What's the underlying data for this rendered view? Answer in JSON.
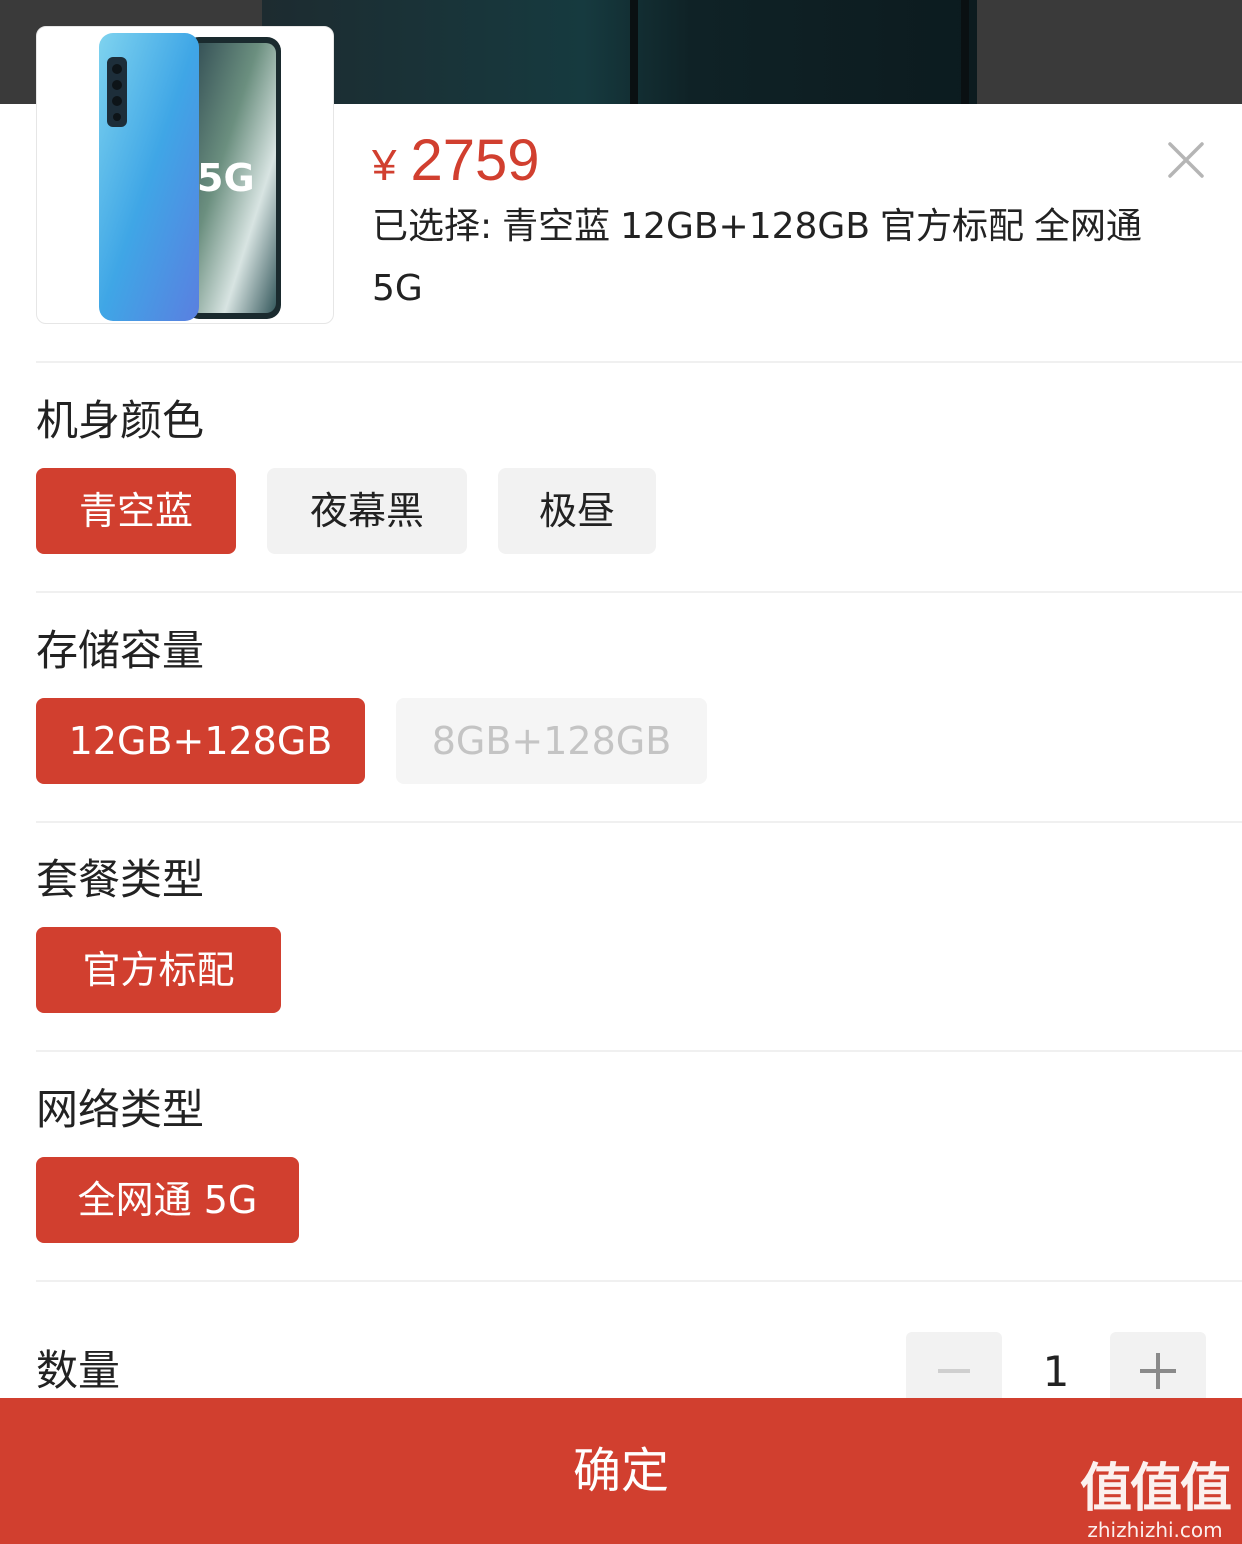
{
  "product": {
    "price_currency": "¥",
    "price_value": "2759",
    "selected_label": "已选择:",
    "selected_color": "青空蓝",
    "selected_storage": "12GB+128GB",
    "selected_package": "官方标配",
    "selected_network": "全网通 5G",
    "image_text": "5G"
  },
  "sections": {
    "color": {
      "title": "机身颜色",
      "options": [
        "青空蓝",
        "夜幕黑",
        "极昼"
      ],
      "selected": "青空蓝"
    },
    "storage": {
      "title": "存储容量",
      "options": [
        "12GB+128GB",
        "8GB+128GB"
      ],
      "selected": "12GB+128GB",
      "disabled": [
        "8GB+128GB"
      ]
    },
    "package": {
      "title": "套餐类型",
      "options": [
        "官方标配"
      ],
      "selected": "官方标配"
    },
    "network": {
      "title": "网络类型",
      "options": [
        "全网通 5G"
      ],
      "selected": "全网通 5G"
    },
    "quantity": {
      "title": "数量",
      "value": "1"
    }
  },
  "confirm_label": "确定",
  "watermark": {
    "logo": "值值值",
    "site": "zhizhizhi.com"
  },
  "colors": {
    "accent": "#d13f2f",
    "chip_idle": "#f2f2f2",
    "disabled_text": "#c4c4c4"
  },
  "icons": {
    "close": "close-icon",
    "minus": "minus-icon",
    "plus": "plus-icon"
  }
}
